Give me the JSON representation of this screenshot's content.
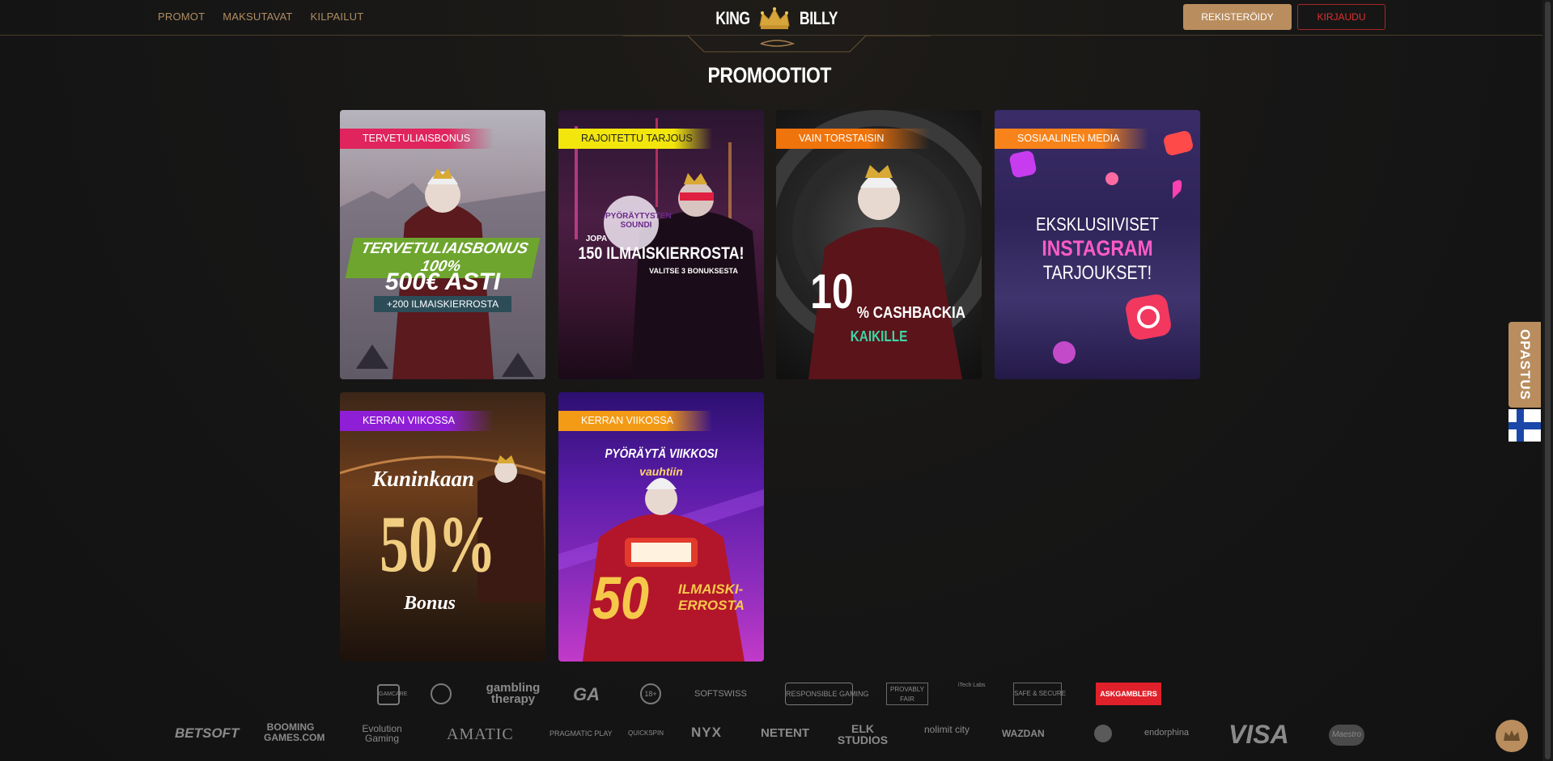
{
  "nav": {
    "items": [
      "PROMOT",
      "MAKSUTAVAT",
      "KILPAILUT"
    ]
  },
  "logo": {
    "left": "KING",
    "right": "BILLY"
  },
  "buttons": {
    "register": "REKISTERÖIDY",
    "login": "KIRJAUDU"
  },
  "page": {
    "title": "PROMOOTIOT"
  },
  "promos": [
    {
      "tag": "TERVETULIAISBONUS",
      "line1": "TERVETULIAISBONUS 100%",
      "line2": "500€ ASTI",
      "line3": "+200 ILMAISKIERROSTA"
    },
    {
      "tag": "RAJOITETTU TARJOUS",
      "badge": "PYÖRÄYTYSTEN SOUNDI",
      "line1": "JOPA",
      "line2": "150 ILMAISKIERROSTA!",
      "line3": "VALITSE 3 BONUKSESTA"
    },
    {
      "tag": "VAIN TORSTAISIN",
      "line1": "10",
      "line2": "% CASHBACKIA",
      "line3": "KAIKILLE"
    },
    {
      "tag": "SOSIAALINEN MEDIA",
      "line1": "EKSKLUSIIVISET",
      "line2": "INSTAGRAM",
      "line3": "TARJOUKSET!"
    },
    {
      "tag": "KERRAN VIIKOSSA",
      "line1": "Kuninkaan",
      "line2": "50%",
      "line3": "Bonus"
    },
    {
      "tag": "KERRAN VIIKOSSA",
      "line1": "PYÖRÄYTÄ VIIKKOSI",
      "line2": "vauhtiin",
      "line3": "50",
      "line4": "ILMAISKI-ERROSTA"
    }
  ],
  "trust_logos": [
    "GAMCARE",
    "gambling therapy",
    "GA",
    "18+",
    "SOFTSWISS",
    "RESPONSIBLE GAMING",
    "PROVABLY FAIR",
    "iTech Labs",
    "SAFE & SECURE",
    "ASKGAMBLERS"
  ],
  "provider_logos": [
    "BETSOFT",
    "BOOMING GAMES.COM",
    "Evolution Gaming",
    "AMATIC",
    "PRAGMATIC PLAY",
    "QUICKSPIN",
    "NYX",
    "NETENT",
    "ELK STUDIOS",
    "nolimit city",
    "WAZDAN",
    "endorphina",
    "VISA",
    "Maestro"
  ],
  "side": {
    "help_tab": "OPASTUS"
  },
  "colors": {
    "accent": "#b98d5e",
    "login": "#e02f2f",
    "background": "#161616"
  }
}
